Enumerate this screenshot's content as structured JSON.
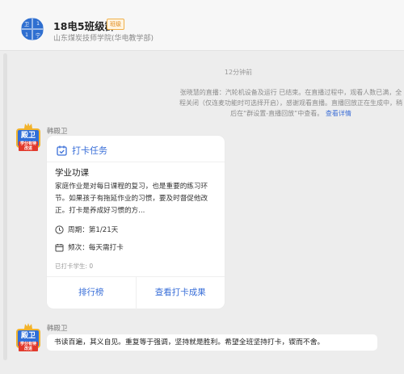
{
  "header": {
    "title": "18电5班级群",
    "badge": "班级",
    "subtitle": "山东煤炭技师学院(华电教学部)",
    "avatar_chars": [
      "卫",
      "1",
      "1",
      "宁"
    ]
  },
  "chat": {
    "timestamp": "12分钟前",
    "system_notice": {
      "text": "张晓慧的直播：汽轮机设备及运行 已结束。在直播过程中，观看人数已满，全程关闭（仅连麦功能时可选择开启），感谢观看直播。直播回放正在生成中，稍后在“群设置-直播回放”中查看。",
      "link": "查看详情"
    },
    "messages": [
      {
        "sender": "韩殿卫",
        "avatar_text": "殿卫",
        "avatar_sub": "学分有待改进",
        "card": {
          "title": "打卡任务",
          "heading": "学业功课",
          "description": "家庭作业是对每日课程的复习，也是重要的练习环节。如果孩子有拖延作业的习惯，要及时督促他改正。打卡是养成好习惯的方...",
          "period_label": "周期：第1/21天",
          "frequency_label": "频次：每天需打卡",
          "count_label": "已打卡学生: 0",
          "button_left": "排行榜",
          "button_right": "查看打卡成果"
        }
      },
      {
        "sender": "韩殿卫",
        "avatar_text": "殿卫",
        "avatar_sub": "学分有待改进",
        "text": "书读百遍，其义自见。重复等于强调，坚持就是胜利。希望全班坚持打卡，锲而不舍。"
      }
    ]
  },
  "colors": {
    "accent": "#3a6fd8",
    "background": "#ededed",
    "badge": "#f0b04a"
  },
  "icons": [
    "calendar-check-icon",
    "clock-icon",
    "calendar-icon",
    "crown-icon"
  ]
}
